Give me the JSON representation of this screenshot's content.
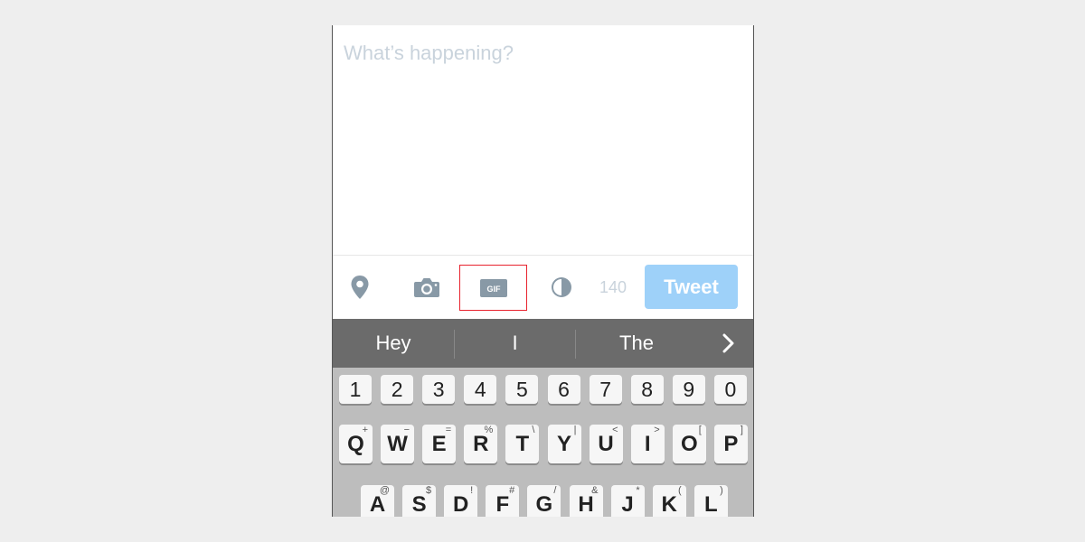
{
  "compose": {
    "placeholder": "What’s happening?"
  },
  "toolbar": {
    "location_icon": "location-pin-icon",
    "camera_icon": "camera-icon",
    "gif_icon": "gif-icon",
    "gif_label": "GIF",
    "poll_icon": "poll-icon",
    "char_count": "140",
    "tweet_label": "Tweet",
    "highlight_color": "#e8232e",
    "tweet_color": "#9ed1f9"
  },
  "suggestions": {
    "items": [
      "Hey",
      "I",
      "The"
    ],
    "more_icon": "chevron-right-icon"
  },
  "keyboard": {
    "numbers": [
      "1",
      "2",
      "3",
      "4",
      "5",
      "6",
      "7",
      "8",
      "9",
      "0"
    ],
    "row_q": [
      {
        "key": "Q",
        "sub": "+"
      },
      {
        "key": "W",
        "sub": "−"
      },
      {
        "key": "E",
        "sub": "="
      },
      {
        "key": "R",
        "sub": "%"
      },
      {
        "key": "T",
        "sub": "\\"
      },
      {
        "key": "Y",
        "sub": "|"
      },
      {
        "key": "U",
        "sub": "<"
      },
      {
        "key": "I",
        "sub": ">"
      },
      {
        "key": "O",
        "sub": "["
      },
      {
        "key": "P",
        "sub": "]"
      }
    ],
    "row_a": [
      {
        "key": "A",
        "sub": "@"
      },
      {
        "key": "S",
        "sub": "$"
      },
      {
        "key": "D",
        "sub": "!"
      },
      {
        "key": "F",
        "sub": "#"
      },
      {
        "key": "G",
        "sub": "/"
      },
      {
        "key": "H",
        "sub": "&"
      },
      {
        "key": "J",
        "sub": "*"
      },
      {
        "key": "K",
        "sub": "("
      },
      {
        "key": "L",
        "sub": ")"
      }
    ]
  }
}
